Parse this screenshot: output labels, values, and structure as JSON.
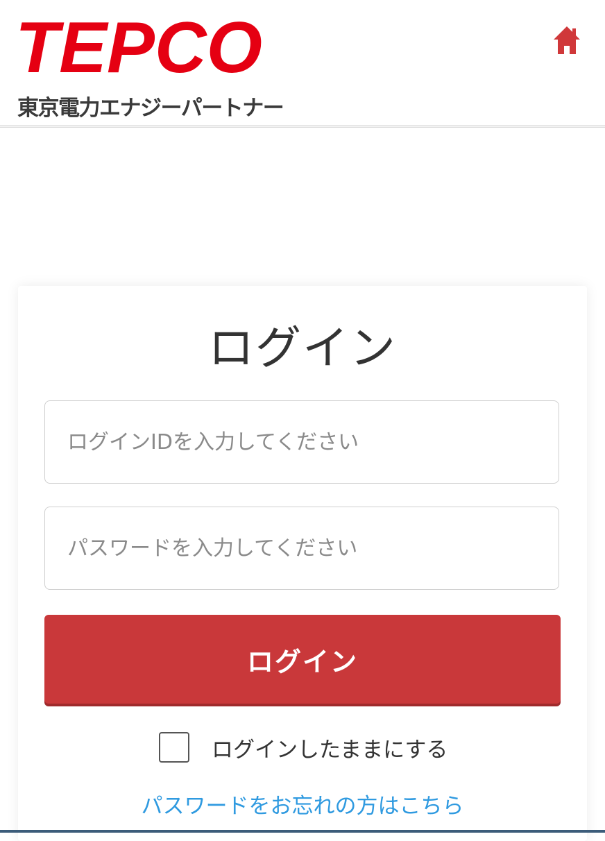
{
  "header": {
    "logo_text": "TEPCO",
    "logo_subtitle": "東京電力エナジーパートナー",
    "home_icon": "home-icon"
  },
  "login": {
    "title": "ログイン",
    "login_id_placeholder": "ログインIDを入力してください",
    "password_placeholder": "パスワードを入力してください",
    "submit_label": "ログイン",
    "remember_label": "ログインしたままにする",
    "remember_checked": false,
    "forgot_link": "パスワードをお忘れの方はこちら"
  },
  "colors": {
    "brand_red": "#e50012",
    "button_red": "#c9383a",
    "link_blue": "#2f9ae0",
    "text_dark": "#333333"
  }
}
